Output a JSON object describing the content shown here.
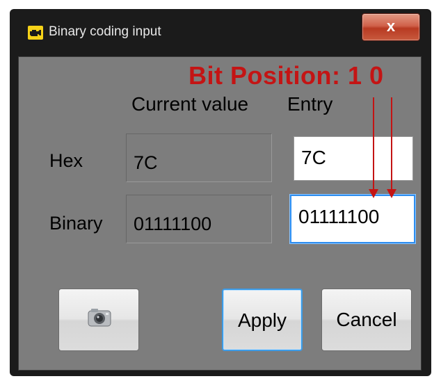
{
  "window": {
    "title": "Binary coding input",
    "close_label": "x"
  },
  "annotation": {
    "bit_position_label": "Bit Position: 1 0"
  },
  "columns": {
    "current": "Current value",
    "entry": "Entry"
  },
  "rows": {
    "hex": {
      "label": "Hex",
      "current": "7C",
      "entry": "7C"
    },
    "binary": {
      "label": "Binary",
      "current": "01111100",
      "entry": "01111100"
    }
  },
  "buttons": {
    "snapshot_icon": "camera-icon",
    "apply": "Apply",
    "cancel": "Cancel"
  },
  "colors": {
    "annotation": "#c41414",
    "focus_border": "#2e8ef0",
    "title_icon": "#f6d218"
  }
}
